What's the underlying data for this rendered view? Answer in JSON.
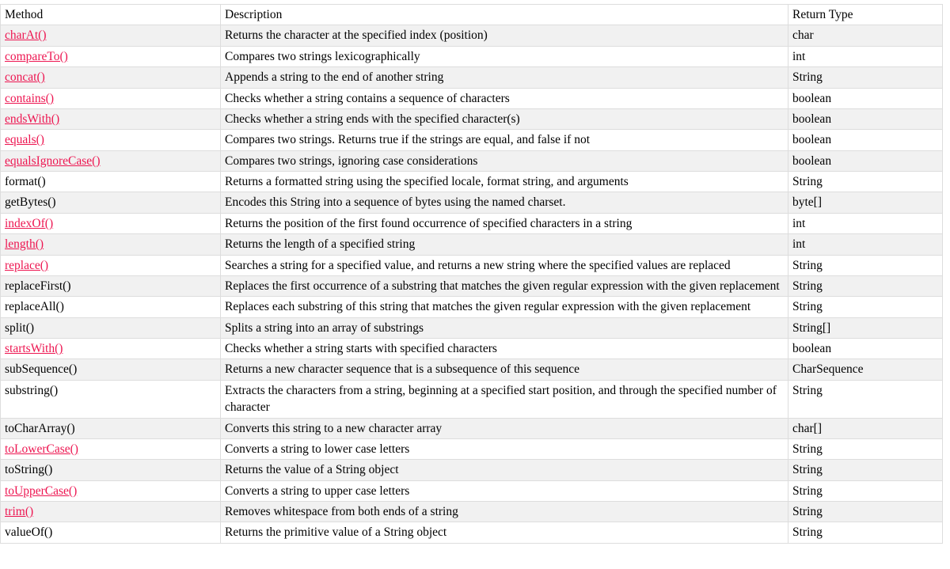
{
  "table": {
    "name": "java-string-methods",
    "columns": [
      {
        "key": "method",
        "label": "Method"
      },
      {
        "key": "description",
        "label": "Description"
      },
      {
        "key": "return_type",
        "label": "Return Type"
      }
    ],
    "link_color": "#ed1651",
    "text_color": "#000000",
    "row_shade_color": "#f1f1f1",
    "border_color": "#dddddd",
    "rows": [
      {
        "method": "charAt()",
        "is_link": true,
        "description": "Returns the character at the specified index (position)",
        "return_type": "char"
      },
      {
        "method": "compareTo()",
        "is_link": true,
        "description": "Compares two strings lexicographically",
        "return_type": "int"
      },
      {
        "method": "concat()",
        "is_link": true,
        "description": "Appends a string to the end of another string",
        "return_type": "String"
      },
      {
        "method": "contains()",
        "is_link": true,
        "description": "Checks whether a string contains a sequence of characters",
        "return_type": "boolean"
      },
      {
        "method": "endsWith()",
        "is_link": true,
        "description": "Checks whether a string ends with the specified character(s)",
        "return_type": "boolean"
      },
      {
        "method": "equals()",
        "is_link": true,
        "description": "Compares two strings. Returns true if the strings are equal, and false if not",
        "return_type": "boolean"
      },
      {
        "method": "equalsIgnoreCase()",
        "is_link": true,
        "description": "Compares two strings, ignoring case considerations",
        "return_type": "boolean"
      },
      {
        "method": "format()",
        "is_link": false,
        "description": "Returns a formatted string using the specified locale, format string, and arguments",
        "return_type": "String"
      },
      {
        "method": "getBytes()",
        "is_link": false,
        "description": "Encodes this String into a sequence of bytes using the named charset.",
        "return_type": "byte[]"
      },
      {
        "method": "indexOf()",
        "is_link": true,
        "description": "Returns the position of the first found occurrence of specified characters in a string",
        "return_type": "int"
      },
      {
        "method": "length()",
        "is_link": true,
        "description": "Returns the length of a specified string",
        "return_type": "int"
      },
      {
        "method": "replace()",
        "is_link": true,
        "description": "Searches a string for a specified value, and returns a new string where the specified values are replaced",
        "return_type": "String"
      },
      {
        "method": "replaceFirst()",
        "is_link": false,
        "description": "Replaces the first occurrence of a substring that matches the given regular expression with the given replacement",
        "return_type": "String"
      },
      {
        "method": "replaceAll()",
        "is_link": false,
        "description": "Replaces each substring of this string that matches the given regular expression with the given replacement",
        "return_type": "String"
      },
      {
        "method": "split()",
        "is_link": false,
        "description": "Splits a string into an array of substrings",
        "return_type": "String[]"
      },
      {
        "method": "startsWith()",
        "is_link": true,
        "description": "Checks whether a string starts with specified characters",
        "return_type": "boolean"
      },
      {
        "method": "subSequence()",
        "is_link": false,
        "description": "Returns a new character sequence that is a subsequence of this sequence",
        "return_type": "CharSequence"
      },
      {
        "method": "substring()",
        "is_link": false,
        "description": "Extracts the characters from a string, beginning at a specified start position, and through the specified number of character",
        "return_type": "String"
      },
      {
        "method": "toCharArray()",
        "is_link": false,
        "description": "Converts this string to a new character array",
        "return_type": "char[]"
      },
      {
        "method": "toLowerCase()",
        "is_link": true,
        "description": "Converts a string to lower case letters",
        "return_type": "String"
      },
      {
        "method": "toString()",
        "is_link": false,
        "description": "Returns the value of a String object",
        "return_type": "String"
      },
      {
        "method": "toUpperCase()",
        "is_link": true,
        "description": "Converts a string to upper case letters",
        "return_type": "String"
      },
      {
        "method": "trim()",
        "is_link": true,
        "description": "Removes whitespace from both ends of a string",
        "return_type": "String"
      },
      {
        "method": "valueOf()",
        "is_link": false,
        "description": "Returns the primitive value of a String object",
        "return_type": "String"
      }
    ]
  }
}
